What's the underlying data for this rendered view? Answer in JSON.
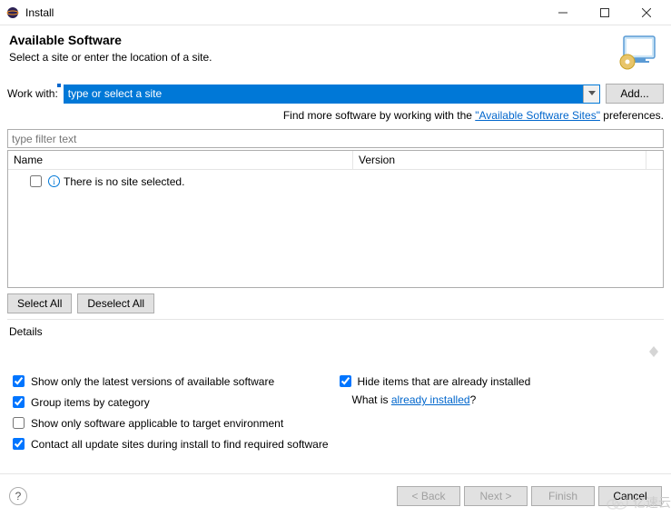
{
  "window": {
    "title": "Install"
  },
  "header": {
    "title": "Available Software",
    "subtitle": "Select a site or enter the location of a site."
  },
  "workwith": {
    "label": "Work with:",
    "placeholder": "type or select a site",
    "value": "type or select a site",
    "add_button": "Add..."
  },
  "findmore": {
    "prefix": "Find more software by working with the ",
    "link": "\"Available Software Sites\"",
    "suffix": " preferences."
  },
  "filter": {
    "placeholder": "type filter text"
  },
  "tree": {
    "columns": {
      "name": "Name",
      "version": "Version"
    },
    "empty_message": "There is no site selected."
  },
  "selection": {
    "select_all": "Select All",
    "deselect_all": "Deselect All"
  },
  "details": {
    "header": "Details"
  },
  "options": {
    "latest_versions": {
      "label": "Show only the latest versions of available software",
      "checked": true
    },
    "group_category": {
      "label": "Group items by category",
      "checked": true
    },
    "applicable_env": {
      "label": "Show only software applicable to target environment",
      "checked": false
    },
    "contact_sites": {
      "label": "Contact all update sites during install to find required software",
      "checked": true
    },
    "hide_installed": {
      "label": "Hide items that are already installed",
      "checked": true
    },
    "whatis": {
      "prefix": "What is ",
      "link": "already installed",
      "suffix": "?"
    }
  },
  "footer": {
    "back": "< Back",
    "next": "Next >",
    "finish": "Finish",
    "cancel": "Cancel"
  },
  "watermark": "亿速云"
}
